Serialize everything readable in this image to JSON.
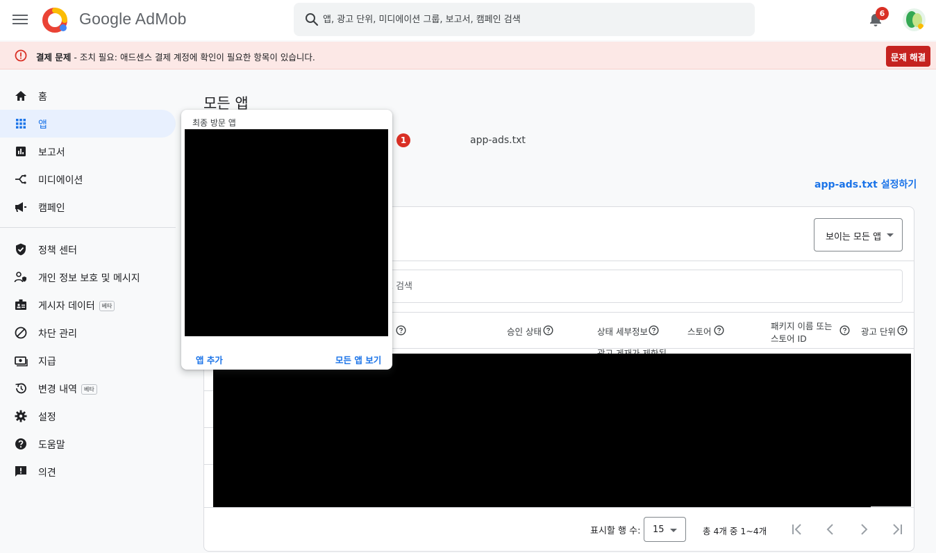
{
  "header": {
    "brand": "Google AdMob",
    "search_placeholder": "앱, 광고 단위, 미디에이션 그룹, 보고서, 캠페인 검색",
    "notification_count": "6"
  },
  "alert": {
    "title": "결제 문제",
    "message": " - 조치 필요: 애드센스 결제 계정에 확인이 필요한 항목이 있습니다.",
    "action_label": "문제 해결"
  },
  "sidebar": {
    "items": [
      {
        "label": "홈",
        "icon": "home-icon"
      },
      {
        "label": "앱",
        "icon": "apps-grid-icon",
        "active": true
      },
      {
        "label": "보고서",
        "icon": "reports-icon"
      },
      {
        "label": "미디에이션",
        "icon": "mediation-icon"
      },
      {
        "label": "캠페인",
        "icon": "campaign-icon"
      },
      {
        "label": "정책 센터",
        "icon": "policy-shield-icon"
      },
      {
        "label": "개인 정보 보호 및 메시지",
        "icon": "privacy-icon"
      },
      {
        "label": "게시자 데이터",
        "icon": "publisher-data-icon",
        "badge": "베타"
      },
      {
        "label": "차단 관리",
        "icon": "block-icon"
      },
      {
        "label": "지급",
        "icon": "payments-icon"
      },
      {
        "label": "변경 내역",
        "icon": "history-icon",
        "badge": "베타"
      },
      {
        "label": "설정",
        "icon": "gear-icon"
      },
      {
        "label": "도움말",
        "icon": "help-icon"
      },
      {
        "label": "의견",
        "icon": "feedback-icon"
      }
    ]
  },
  "main": {
    "title": "모든 앱",
    "tabs": {
      "badge_count": "1",
      "appads_label": "app-ads.txt"
    },
    "setup_link": "app-ads.txt 설정하기",
    "filter_label": "보이는 모든 앱",
    "table_search_placeholder": "로 검색",
    "columns": [
      "승인 상태",
      "상태 세부정보",
      "스토어",
      "패키지 이름 또는",
      "스토어 ID",
      "광고 단위"
    ],
    "partial_cell": "광고 게재가 제한된"
  },
  "pagination": {
    "rows_label": "표시할 행 수:",
    "rows_value": "15",
    "range_text": "총 4개 중 1~4개"
  },
  "popover": {
    "title": "최종 방문 앱",
    "add_app": "앱 추가",
    "view_all": "모든 앱 보기"
  },
  "colors": {
    "accent": "#1a73e8",
    "alert_bg": "#fce8e6",
    "danger": "#c5221f"
  }
}
